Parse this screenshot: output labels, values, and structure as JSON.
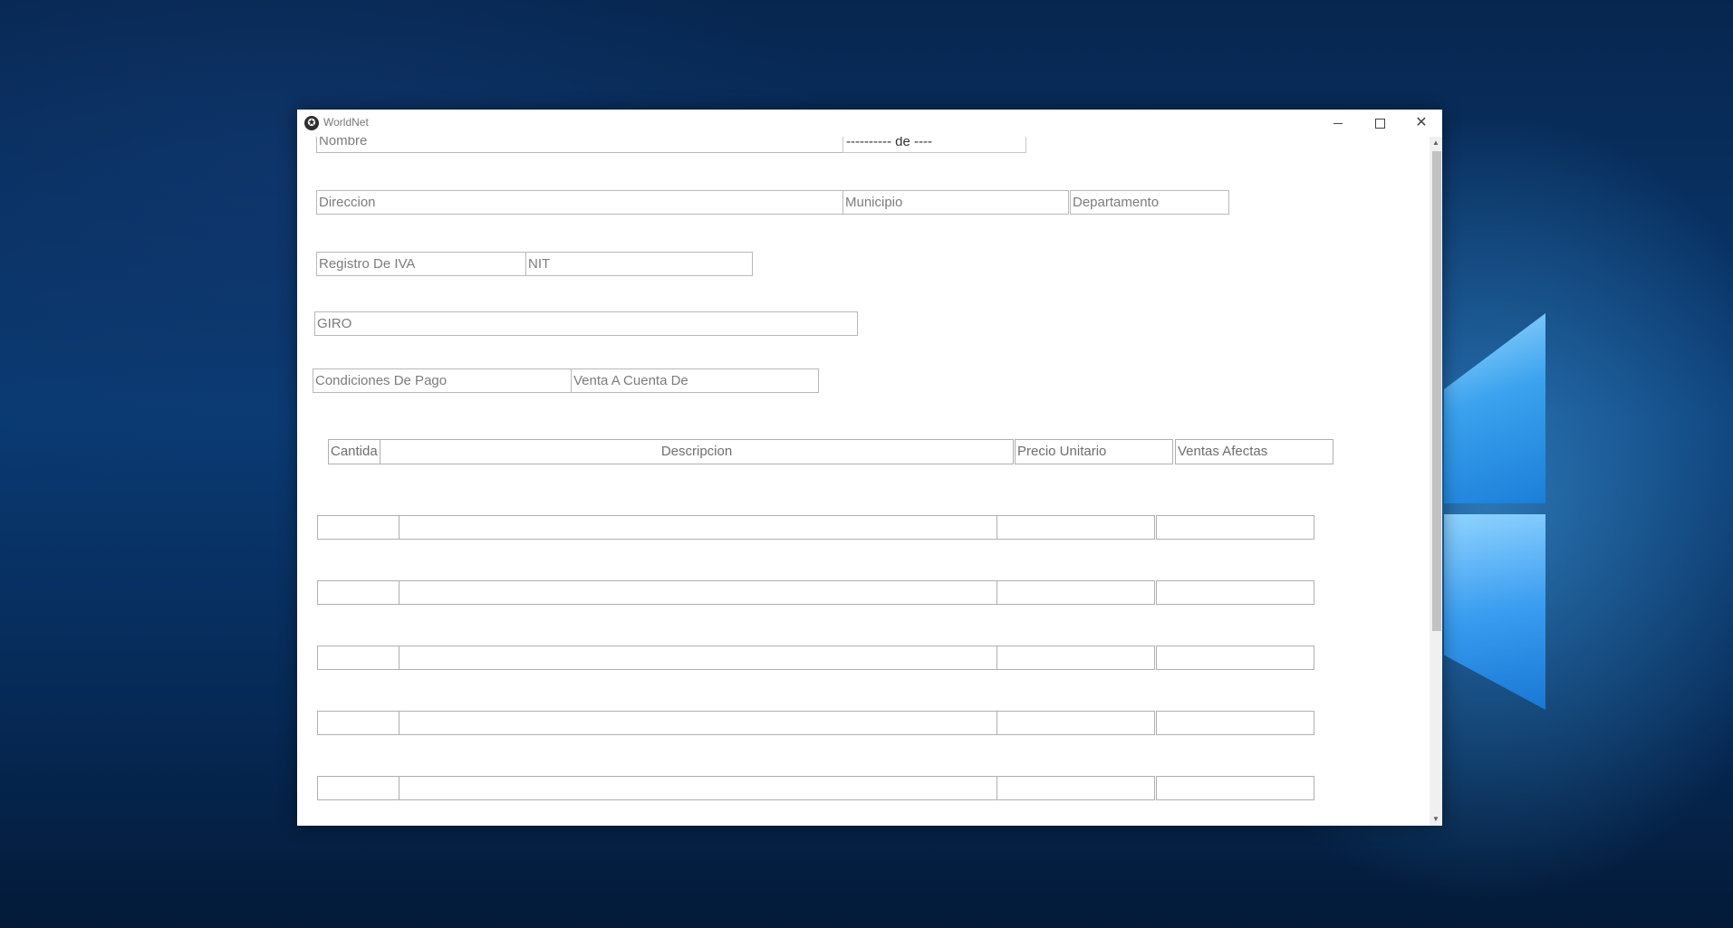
{
  "window": {
    "title": "WorldNet",
    "icon": "worldnet-app-icon",
    "controls": {
      "minimize": "minimize-icon",
      "maximize": "maximize-icon",
      "close": "close-icon"
    }
  },
  "form": {
    "nombre": "Nombre",
    "fecha": "---------- de ----",
    "direccion": "Direccion",
    "municipio": "Municipio",
    "departamento": "Departamento",
    "registro_iva": "Registro De IVA",
    "nit": "NIT",
    "giro": "GIRO",
    "condiciones_pago": "Condiciones De Pago",
    "venta_cuenta": "Venta A Cuenta De"
  },
  "table": {
    "headers": [
      "Cantida",
      "Descripcion",
      "Precio Unitario",
      "Ventas Afectas"
    ],
    "rows": [
      [
        "",
        "",
        "",
        ""
      ],
      [
        "",
        "",
        "",
        ""
      ],
      [
        "",
        "",
        "",
        ""
      ],
      [
        "",
        "",
        "",
        ""
      ],
      [
        "",
        "",
        "",
        ""
      ]
    ]
  }
}
